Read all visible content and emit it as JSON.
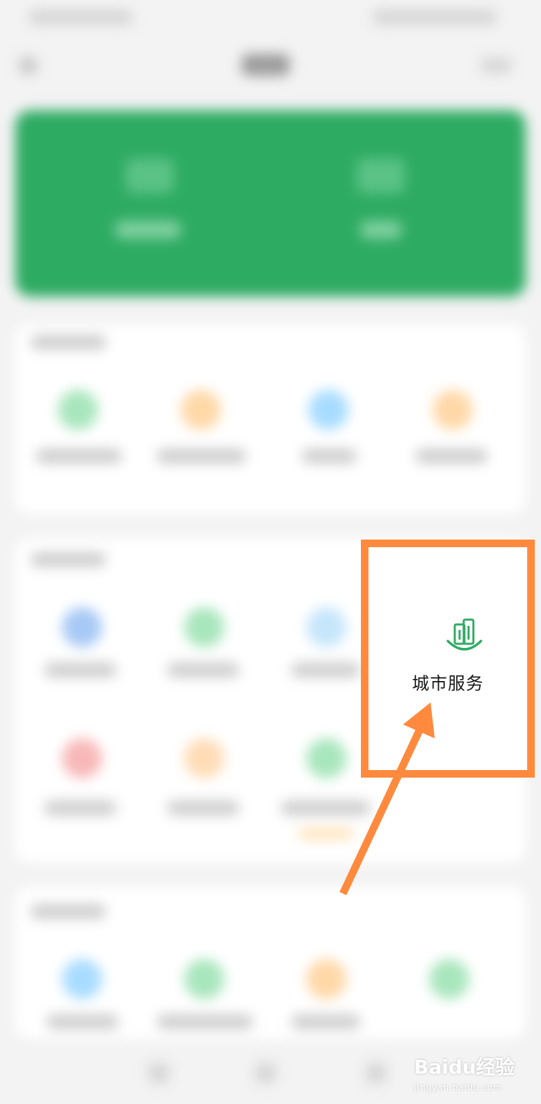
{
  "highlight": {
    "label": "城市服务",
    "icon": "city-buildings-icon",
    "border_color": "#ff8a3d",
    "icon_color": "#2eab63"
  },
  "watermark": {
    "brand": "Baidu经验",
    "url": "jingyan.baidu.com"
  },
  "colors": {
    "accent_green": "#2eab63",
    "arrow_orange": "#ff8a3d"
  }
}
